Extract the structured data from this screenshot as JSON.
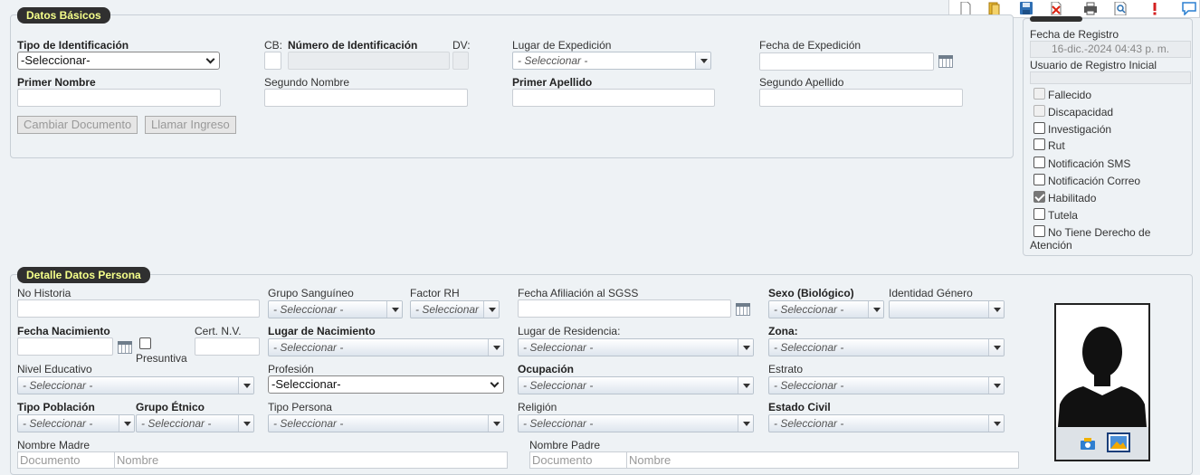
{
  "datos_basicos": {
    "legend": "Datos Básicos",
    "tipo_identificacion_label": "Tipo de Identificación",
    "tipo_identificacion_value": "-Seleccionar-",
    "cb_label": "CB:",
    "numero_identificacion_label": "Número de Identificación",
    "dv_label": "DV:",
    "lugar_expedicion_label": "Lugar de Expedición",
    "lugar_expedicion_value": "- Seleccionar -",
    "fecha_expedicion_label": "Fecha de Expedición",
    "primer_nombre_label": "Primer Nombre",
    "segundo_nombre_label": "Segundo Nombre",
    "primer_apellido_label": "Primer Apellido",
    "segundo_apellido_label": "Segundo Apellido",
    "cambiar_documento_button": "Cambiar Documento",
    "llamar_ingreso_button": "Llamar Ingreso"
  },
  "registro": {
    "fecha_registro_label": "Fecha de Registro",
    "fecha_registro_value": "16-dic.-2024 04:43 p. m.",
    "usuario_registro_label": "Usuario de Registro Inicial",
    "checkboxes": [
      {
        "label": "Fallecido",
        "checked": false,
        "disabled": true
      },
      {
        "label": "Discapacidad",
        "checked": false,
        "disabled": true
      },
      {
        "label": "Investigación",
        "checked": false,
        "disabled": false
      },
      {
        "label": "Rut",
        "checked": false,
        "disabled": false
      },
      {
        "label": "Notificación SMS",
        "checked": false,
        "disabled": false
      },
      {
        "label": "Notificación Correo",
        "checked": false,
        "disabled": false
      },
      {
        "label": "Habilitado",
        "checked": true,
        "disabled": false
      },
      {
        "label": "Tutela",
        "checked": false,
        "disabled": false
      }
    ],
    "no_derecho_line1": "No Tiene Derecho de",
    "no_derecho_line2": "Atención"
  },
  "detalle": {
    "legend": "Detalle Datos Persona",
    "no_historia_label": "No Historia",
    "grupo_sanguineo_label": "Grupo Sanguíneo",
    "grupo_sanguineo_value": "- Seleccionar -",
    "factor_rh_label": "Factor RH",
    "factor_rh_value": "- Seleccionar",
    "fecha_afiliacion_label": "Fecha Afiliación al SGSS",
    "sexo_label": "Sexo (Biológico)",
    "sexo_value": "- Seleccionar -",
    "identidad_genero_label": "Identidad Género",
    "fecha_nacimiento_label": "Fecha Nacimiento",
    "presuntiva_label": "Presuntiva",
    "cert_nv_label": "Cert. N.V.",
    "lugar_nacimiento_label": "Lugar de Nacimiento",
    "lugar_nacimiento_value": "- Seleccionar -",
    "lugar_residencia_label": "Lugar de Residencia:",
    "lugar_residencia_value": "- Seleccionar -",
    "zona_label": "Zona:",
    "zona_value": "- Seleccionar -",
    "nivel_educativo_label": "Nivel Educativo",
    "nivel_educativo_value": "- Seleccionar -",
    "profesion_label": "Profesión",
    "profesion_value": "-Seleccionar-",
    "ocupacion_label": "Ocupación",
    "ocupacion_value": "- Seleccionar -",
    "estrato_label": "Estrato",
    "estrato_value": "- Seleccionar -",
    "tipo_poblacion_label": "Tipo Población",
    "tipo_poblacion_value": "- Seleccionar -",
    "grupo_etnico_label": "Grupo Étnico",
    "grupo_etnico_value": "- Seleccionar -",
    "tipo_persona_label": "Tipo Persona",
    "tipo_persona_value": "- Seleccionar -",
    "religion_label": "Religión",
    "religion_value": "- Seleccionar -",
    "estado_civil_label": "Estado Civil",
    "estado_civil_value": "- Seleccionar -",
    "nombre_madre_label": "Nombre Madre",
    "nombre_padre_label": "Nombre Padre",
    "documento_placeholder": "Documento",
    "nombre_placeholder": "Nombre"
  },
  "toolbar_icons": [
    "new-file-icon",
    "open-folder-icon",
    "save-icon",
    "delete-icon",
    "print-icon",
    "preview-icon",
    "alert-icon",
    "comment-icon"
  ]
}
